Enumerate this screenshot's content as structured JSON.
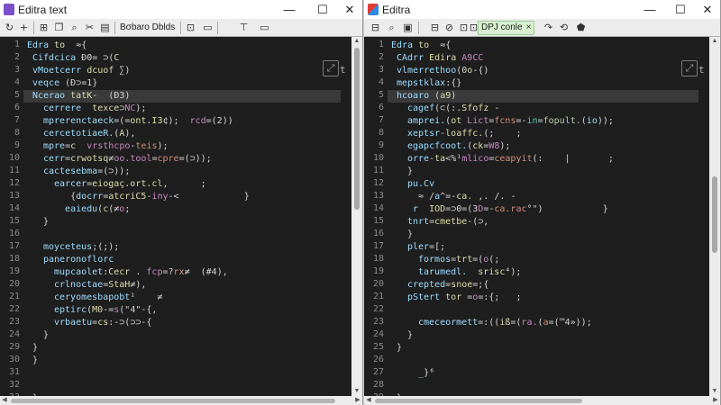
{
  "colors": {
    "keyword": "#c586c0",
    "function": "#dcdcaa",
    "string": "#ce9178",
    "number": "#b5cea8",
    "variable": "#9cdcfe",
    "type": "#4ec9b0",
    "plain": "#d4d4d4"
  },
  "left": {
    "title": "Editra text",
    "app_icon": "editra-purple-icon",
    "window_buttons": {
      "minimize": "—",
      "maximize": "☐",
      "close": "✕"
    },
    "toolbar": {
      "icons": [
        "tab-undo-icon",
        "add-icon",
        "new-tab-icon",
        "copy-icon",
        "search-icon",
        "cut-icon",
        "paste-icon"
      ],
      "tab_label": "Bσbaro Dblds",
      "extra_icons": [
        "screenshot-icon",
        "format-icon",
        "pin-icon",
        "window-icon"
      ]
    },
    "peek": {
      "icon": "peek-icon",
      "label": "t"
    },
    "lines": [
      {
        "n": "1",
        "indent": 0,
        "t": "Edra to  ≈{"
      },
      {
        "n": "2",
        "indent": 1,
        "t": "Cifdcica Ð0= ⊃(C"
      },
      {
        "n": "3",
        "indent": 1,
        "t": "vMoetcerr dcuof ∑)"
      },
      {
        "n": "4",
        "indent": 1,
        "t": "veqce (Ð⊃=1}"
      },
      {
        "n": "5",
        "indent": 1,
        "t": "Ncerao tatK-  (Ð3)",
        "hl": true
      },
      {
        "n": "6",
        "indent": 3,
        "t": "cerrere  texce⊃NC);"
      },
      {
        "n": "7",
        "indent": 3,
        "t": "mprerenctaeck=(=ont.I3¢);  rcd=(2))"
      },
      {
        "n": "8",
        "indent": 3,
        "t": "cercetotiaeR.(A),"
      },
      {
        "n": "9",
        "indent": 3,
        "t": "mpre=c  vrsthcpo-teis);"
      },
      {
        "n": "10",
        "indent": 3,
        "t": "cerr=crwotsq≠oo.tool=cpre=(⊃));"
      },
      {
        "n": "11",
        "indent": 3,
        "t": "cactesebma=(⊃));"
      },
      {
        "n": "12",
        "indent": 5,
        "t": "earcer=eiogaç.ort.cl,      ;"
      },
      {
        "n": "13",
        "indent": 5,
        "t": "   {docrr=atcriC5-iny-<            }"
      },
      {
        "n": "14",
        "indent": 5,
        "t": "  eaiedu(c(≠o;"
      },
      {
        "n": "15",
        "indent": 3,
        "t": "}"
      },
      {
        "n": "16",
        "indent": 0,
        "t": ""
      },
      {
        "n": "17",
        "indent": 3,
        "t": "moyceteus;(;);"
      },
      {
        "n": "18",
        "indent": 3,
        "t": "paneronoflorc"
      },
      {
        "n": "19",
        "indent": 5,
        "t": "mupcaolet:Cecr . fcp=?rx≠  (#4),"
      },
      {
        "n": "20",
        "indent": 5,
        "t": "crlnoctae=StaH≠),"
      },
      {
        "n": "21",
        "indent": 5,
        "t": "ceryomesbapobt¹    ≠"
      },
      {
        "n": "22",
        "indent": 5,
        "t": "eptirc(M0-=s(\"4\"-{,"
      },
      {
        "n": "23",
        "indent": 5,
        "t": "vrbaetu=cs:-⊃(⊃⊃-{"
      },
      {
        "n": "24",
        "indent": 3,
        "t": "}"
      },
      {
        "n": "29",
        "indent": 1,
        "t": "}"
      },
      {
        "n": "30",
        "indent": 1,
        "t": "}"
      },
      {
        "n": "31",
        "indent": 0,
        "t": ""
      },
      {
        "n": "32",
        "indent": 0,
        "t": ""
      },
      {
        "n": "33",
        "indent": 1,
        "t": "}"
      },
      {
        "n": "34",
        "indent": 0,
        "t": ""
      }
    ]
  },
  "right": {
    "title": "Editra",
    "app_icon": "editra-color-icon",
    "window_buttons": {
      "minimize": "—",
      "maximize": "☐",
      "close": "✕"
    },
    "toolbar": {
      "icons": [
        "new-file-icon",
        "open-icon",
        "save-icon",
        "find-icon",
        "cut-icon",
        "copy-icon",
        "paste-icon",
        "undo-icon"
      ],
      "tab_label": "DPJ conle",
      "tab_close": "×",
      "extra_icons": [
        "redo-icon",
        "shield-icon"
      ]
    },
    "peek": {
      "icon": "peek-icon",
      "label": "t"
    },
    "lines": [
      {
        "n": "1",
        "indent": 0,
        "t": "Edra to  ≈{"
      },
      {
        "n": "2",
        "indent": 1,
        "t": "CAdrr Edira A9CC"
      },
      {
        "n": "3",
        "indent": 1,
        "t": "vlmerrethoo(0o-{)"
      },
      {
        "n": "4",
        "indent": 1,
        "t": "mepstklax:{}"
      },
      {
        "n": "5",
        "indent": 1,
        "t": "hcoaro (a9)",
        "hl": true
      },
      {
        "n": "6",
        "indent": 3,
        "t": "cagef(⊂(:.Sfofz -"
      },
      {
        "n": "7",
        "indent": 3,
        "t": "amprei.(ot Lict=fcns=-in=fopult.(io));"
      },
      {
        "n": "8",
        "indent": 3,
        "t": "xeptsr-loaffc.(;    ;"
      },
      {
        "n": "9",
        "indent": 3,
        "t": "egapcfcoot.(ck=W8);"
      },
      {
        "n": "10",
        "indent": 3,
        "t": "orre-ta<%¹mlico=ceapyit(:    |       ;"
      },
      {
        "n": "11",
        "indent": 3,
        "t": "}"
      },
      {
        "n": "12",
        "indent": 3,
        "t": "pu.Cv"
      },
      {
        "n": "13",
        "indent": 3,
        "t": "  ≈ /a^=-ca. ,. /. -"
      },
      {
        "n": "14",
        "indent": 3,
        "t": " r  IOD=⊃0=(3D=-ca.rac°\")           }"
      },
      {
        "n": "15",
        "indent": 3,
        "t": "tnrt=cmetbe-(⊃,"
      },
      {
        "n": "16",
        "indent": 3,
        "t": "}"
      },
      {
        "n": "17",
        "indent": 3,
        "t": "pler=[;"
      },
      {
        "n": "18",
        "indent": 5,
        "t": "formos=trt=(o(;"
      },
      {
        "n": "19",
        "indent": 5,
        "t": "tarumedl.  srisc⁴);"
      },
      {
        "n": "20",
        "indent": 3,
        "t": "crepted=snoe=;{"
      },
      {
        "n": "21",
        "indent": 3,
        "t": "pStert tor =o=:{;   ;"
      },
      {
        "n": "22",
        "indent": 0,
        "t": ""
      },
      {
        "n": "23",
        "indent": 5,
        "t": "cmeceormett=:((iß=(ra.(a=(™4»));"
      },
      {
        "n": "24",
        "indent": 3,
        "t": "}"
      },
      {
        "n": "25",
        "indent": 1,
        "t": "}"
      },
      {
        "n": "26",
        "indent": 0,
        "t": ""
      },
      {
        "n": "27",
        "indent": 3,
        "t": "  _}⁶"
      },
      {
        "n": "28",
        "indent": 0,
        "t": ""
      },
      {
        "n": "29",
        "indent": 1,
        "t": "}"
      }
    ]
  }
}
